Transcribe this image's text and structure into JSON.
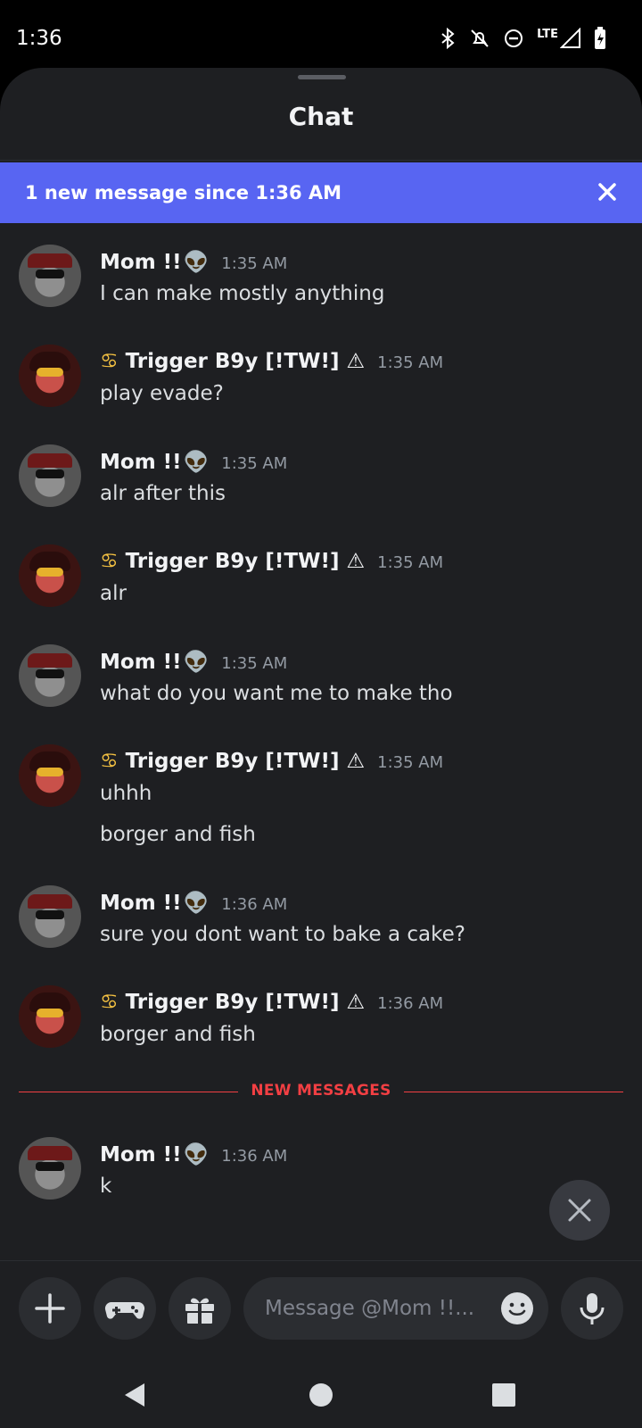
{
  "status": {
    "time": "1:36",
    "icons": [
      "bluetooth-icon",
      "bell-off-icon",
      "dnd-icon",
      "lte-icon",
      "signal-icon",
      "battery-icon"
    ],
    "network_label": "LTE"
  },
  "header": {
    "title": "Chat"
  },
  "banner": {
    "text": "1 new message since 1:36 AM",
    "color": "#5865f2"
  },
  "messages": [
    {
      "author": "Mom !!",
      "emoji": "👽",
      "lead": "",
      "time": "1:35 AM",
      "lines": [
        "I can make mostly anything"
      ],
      "avatar": "mom"
    },
    {
      "author": "Trigger B9y [!TW!]",
      "emoji": "⚠",
      "lead": "♋",
      "time": "1:35 AM",
      "lines": [
        "play evade?"
      ],
      "avatar": "trig"
    },
    {
      "author": "Mom !!",
      "emoji": "👽",
      "lead": "",
      "time": "1:35 AM",
      "lines": [
        "alr after this"
      ],
      "avatar": "mom"
    },
    {
      "author": "Trigger B9y [!TW!]",
      "emoji": "⚠",
      "lead": "♋",
      "time": "1:35 AM",
      "lines": [
        "alr"
      ],
      "avatar": "trig"
    },
    {
      "author": "Mom !!",
      "emoji": "👽",
      "lead": "",
      "time": "1:35 AM",
      "lines": [
        "what do you want me to make tho"
      ],
      "avatar": "mom"
    },
    {
      "author": "Trigger B9y [!TW!]",
      "emoji": "⚠",
      "lead": "♋",
      "time": "1:35 AM",
      "lines": [
        "uhhh",
        "borger and fish"
      ],
      "avatar": "trig"
    },
    {
      "author": "Mom !!",
      "emoji": "👽",
      "lead": "",
      "time": "1:36 AM",
      "lines": [
        "sure you dont want to bake a cake?"
      ],
      "avatar": "mom"
    },
    {
      "author": "Trigger B9y [!TW!]",
      "emoji": "⚠",
      "lead": "♋",
      "time": "1:36 AM",
      "lines": [
        "borger and fish"
      ],
      "avatar": "trig"
    },
    {
      "author": "Mom !!",
      "emoji": "👽",
      "lead": "",
      "time": "1:36 AM",
      "lines": [
        "k"
      ],
      "avatar": "mom"
    }
  ],
  "new_divider": {
    "label": "NEW MESSAGES",
    "color": "#f23f43"
  },
  "composer": {
    "placeholder": "Message @Mom !!...",
    "buttons": [
      "plus-icon",
      "gamepad-icon",
      "gift-icon",
      "emoji-icon",
      "microphone-icon"
    ]
  },
  "navbar": {
    "buttons": [
      "back-icon",
      "home-icon",
      "recents-icon"
    ]
  }
}
